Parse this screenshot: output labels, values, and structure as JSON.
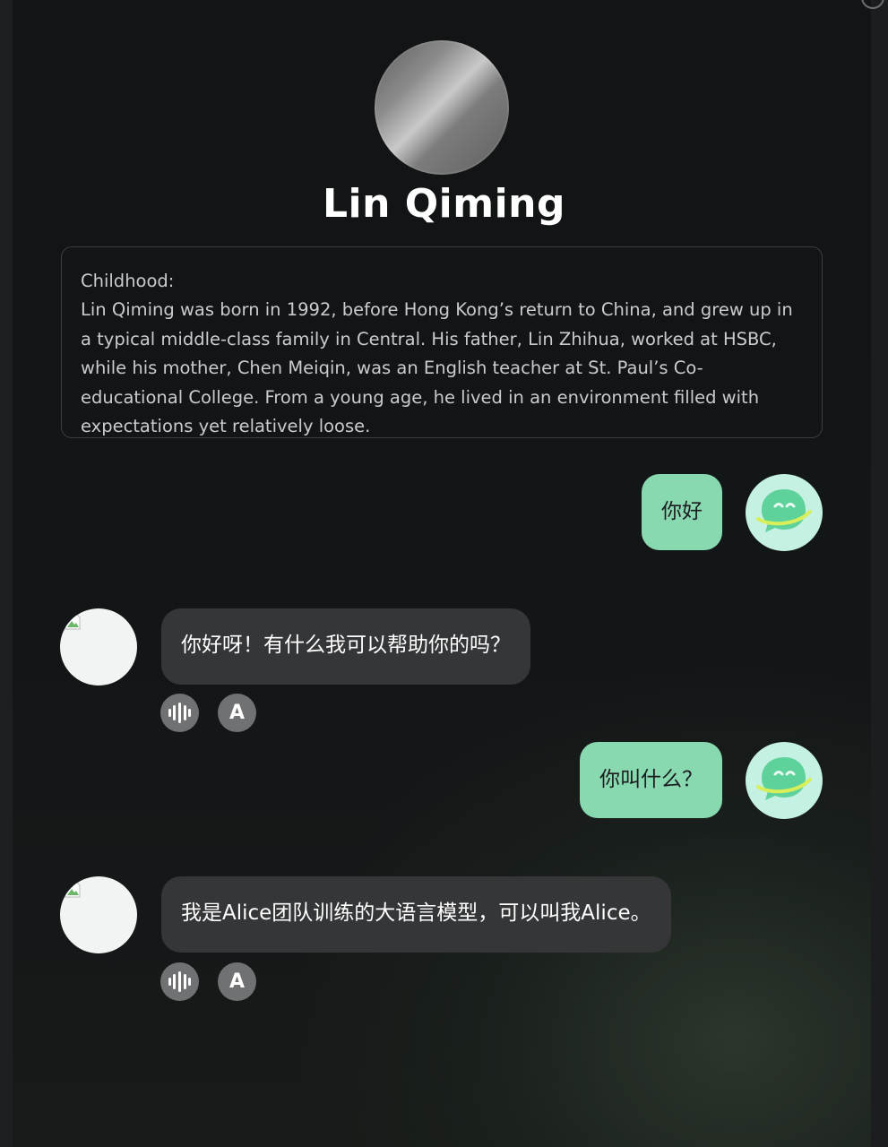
{
  "profile": {
    "name": "Lin Qiming",
    "bio_heading": "Childhood:",
    "bio_text": "Lin Qiming was born in 1992, before Hong Kong’s return to China, and grew up in a typical middle-class family in Central. His father, Lin Zhihua, worked at HSBC, while his mother, Chen Meiqin, was an English teacher at St. Paul’s Co-educational College. From a young age, he lived in an environment filled with expectations yet relatively loose."
  },
  "messages": [
    {
      "role": "user",
      "text": "你好"
    },
    {
      "role": "assistant",
      "text": "你好呀！有什么我可以帮助你的吗？",
      "actions": {
        "voice_icon": "audio-waveform-icon",
        "translate_label": "A"
      }
    },
    {
      "role": "user",
      "text": "你叫什么？"
    },
    {
      "role": "assistant",
      "text": "我是Alice团队训练的大语言模型，可以叫我Alice。",
      "actions": {
        "voice_icon": "audio-waveform-icon",
        "translate_label": "A"
      }
    }
  ],
  "colors": {
    "user_bubble": "#88d8b0",
    "assistant_bubble": "#343638",
    "user_avatar_bg": "#c4f1e1",
    "background": "#141617"
  }
}
